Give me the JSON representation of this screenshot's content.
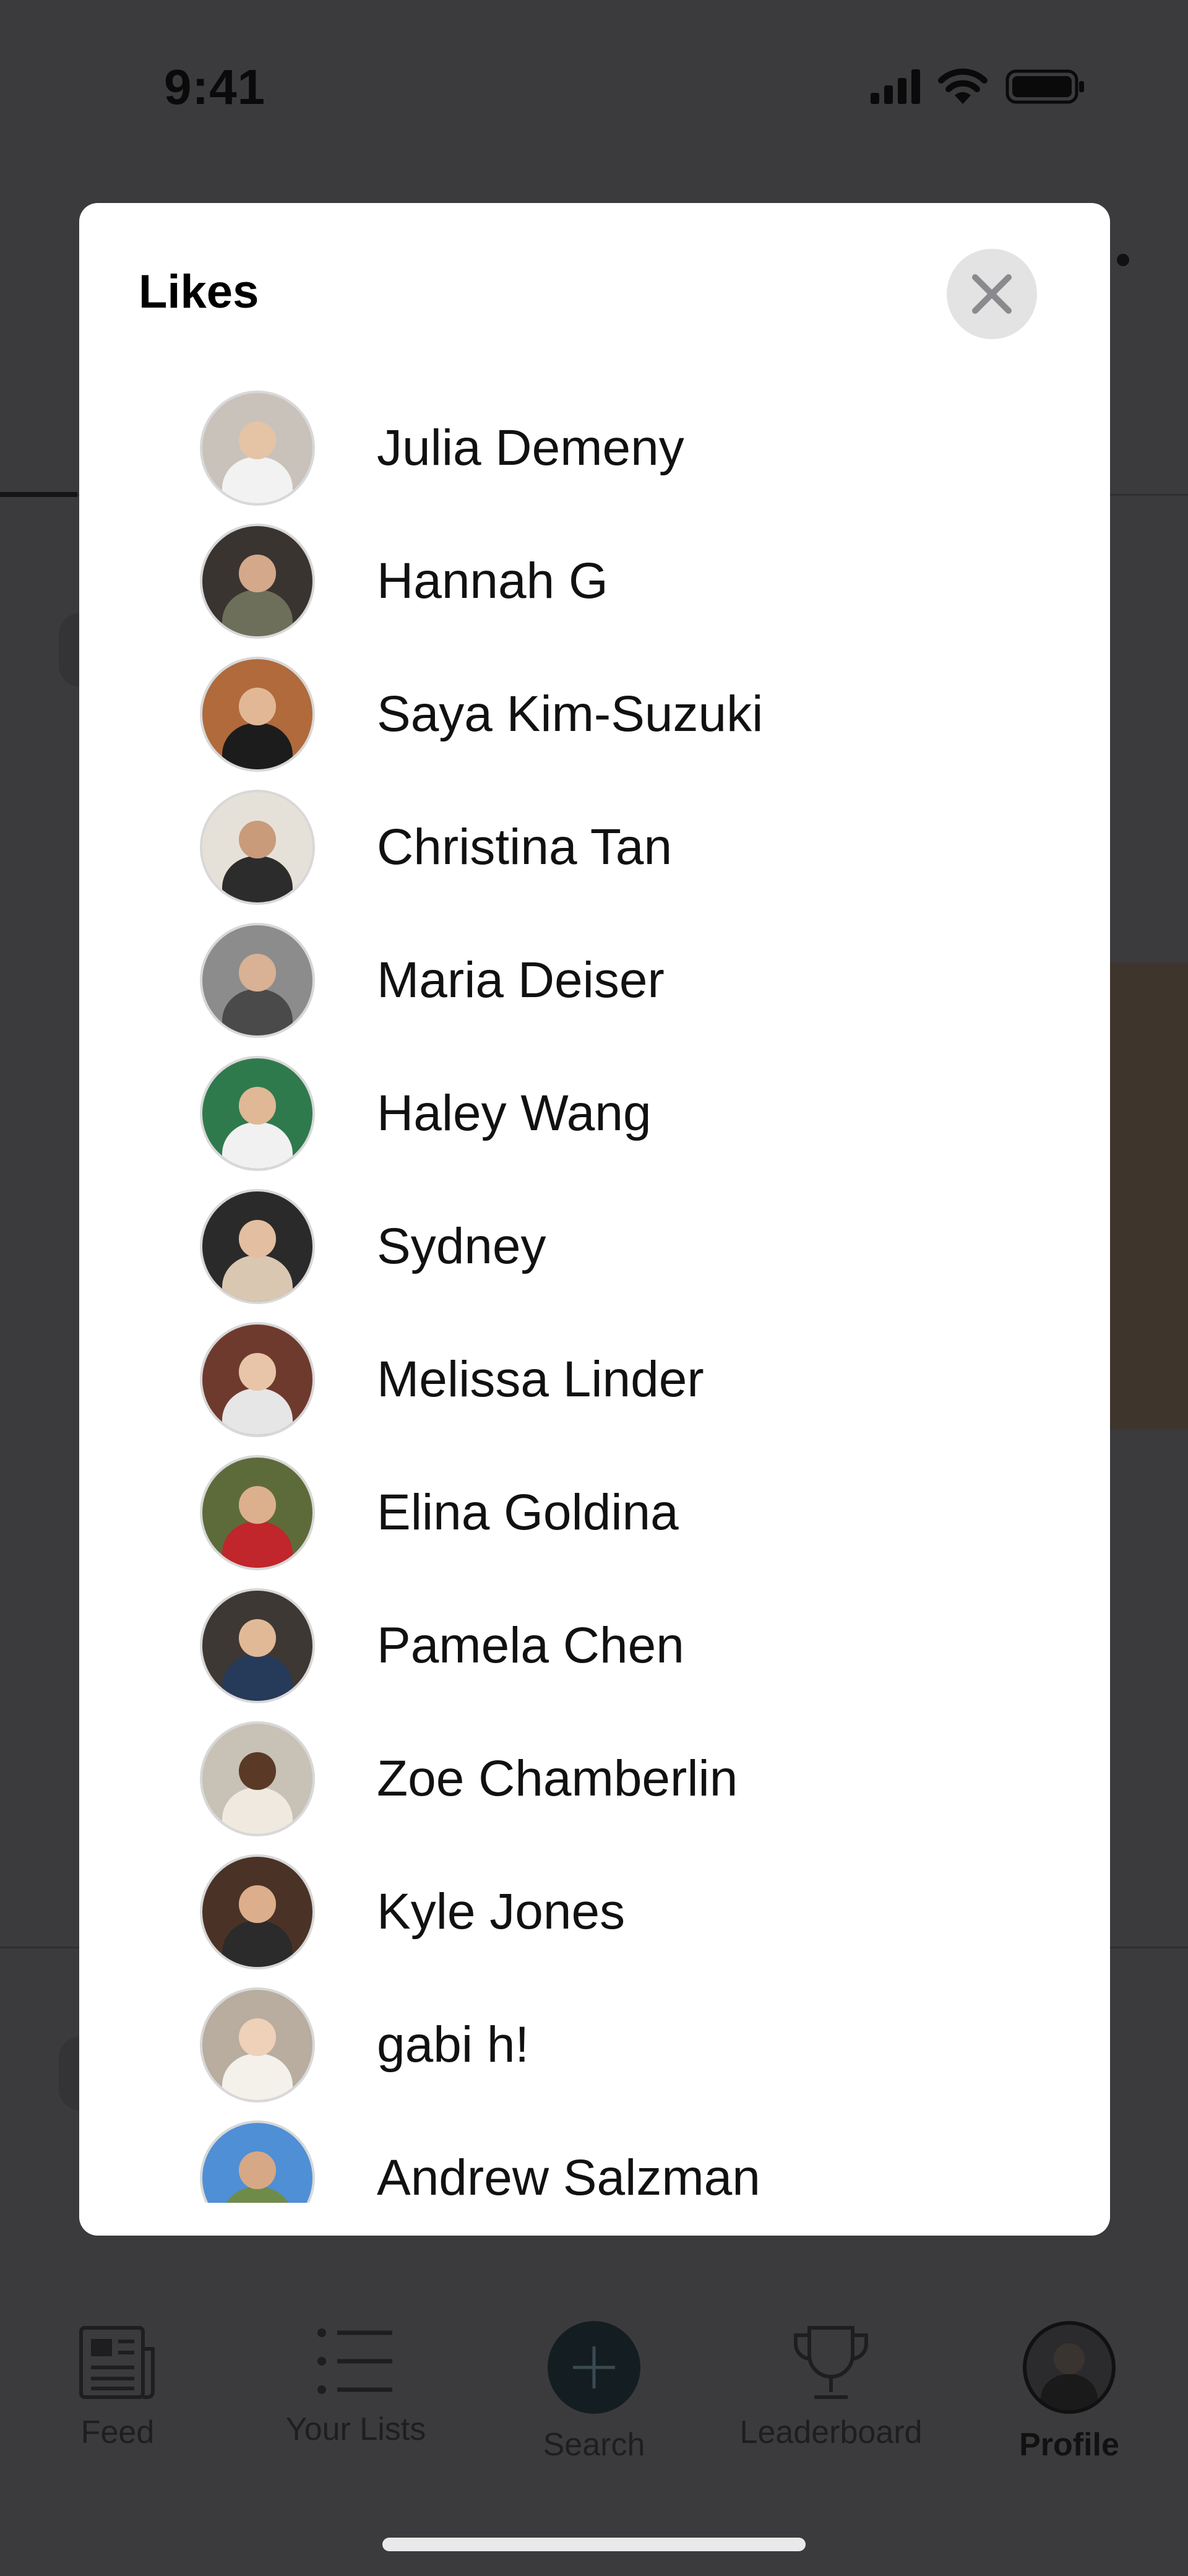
{
  "status_bar": {
    "time": "9:41"
  },
  "modal": {
    "title": "Likes",
    "close_icon": "close-x-icon"
  },
  "likes": [
    {
      "name": "Julia Demeny",
      "bg": "#c9c2bb",
      "skin": "#e5c3a5",
      "shirt": "#f2f2f2"
    },
    {
      "name": "Hannah G",
      "bg": "#3a3430",
      "skin": "#d4a88a",
      "shirt": "#6d6f5a"
    },
    {
      "name": "Saya Kim-Suzuki",
      "bg": "#b06a3b",
      "skin": "#e2b796",
      "shirt": "#1c1c1c"
    },
    {
      "name": "Christina Tan",
      "bg": "#e6e1d8",
      "skin": "#c99b7b",
      "shirt": "#2c2c2c"
    },
    {
      "name": "Maria Deiser",
      "bg": "#8c8c8c",
      "skin": "#d9b194",
      "shirt": "#4a4a4a"
    },
    {
      "name": "Haley Wang",
      "bg": "#2f7a4c",
      "skin": "#e0b896",
      "shirt": "#f1f1f1"
    },
    {
      "name": "Sydney",
      "bg": "#2a2a2a",
      "skin": "#e3bea0",
      "shirt": "#d9c7b2"
    },
    {
      "name": "Melissa Linder",
      "bg": "#6f3a2e",
      "skin": "#e8c5a8",
      "shirt": "#e6e6e6"
    },
    {
      "name": "Elina Goldina",
      "bg": "#5d6b3a",
      "skin": "#dcb08d",
      "shirt": "#c0262c"
    },
    {
      "name": "Pamela Chen",
      "bg": "#3d3834",
      "skin": "#e1b997",
      "shirt": "#263a5a"
    },
    {
      "name": "Zoe Chamberlin",
      "bg": "#c8c2b6",
      "skin": "#5a3a26",
      "shirt": "#efe9df"
    },
    {
      "name": "Kyle Jones",
      "bg": "#4a3326",
      "skin": "#dcae8b",
      "shirt": "#2b2b2b"
    },
    {
      "name": "gabi h!",
      "bg": "#b8ad9f",
      "skin": "#eed1b8",
      "shirt": "#f4f0ea"
    },
    {
      "name": "Andrew Salzman",
      "bg": "#4f8fd6",
      "skin": "#d6a886",
      "shirt": "#6f8b4a"
    }
  ],
  "tabbar": {
    "items": [
      {
        "label": "Feed",
        "icon": "feed-icon"
      },
      {
        "label": "Your Lists",
        "icon": "list-icon"
      },
      {
        "label": "Search",
        "icon": "plus-icon"
      },
      {
        "label": "Leaderboard",
        "icon": "trophy-icon"
      },
      {
        "label": "Profile",
        "icon": "profile-avatar"
      }
    ]
  }
}
